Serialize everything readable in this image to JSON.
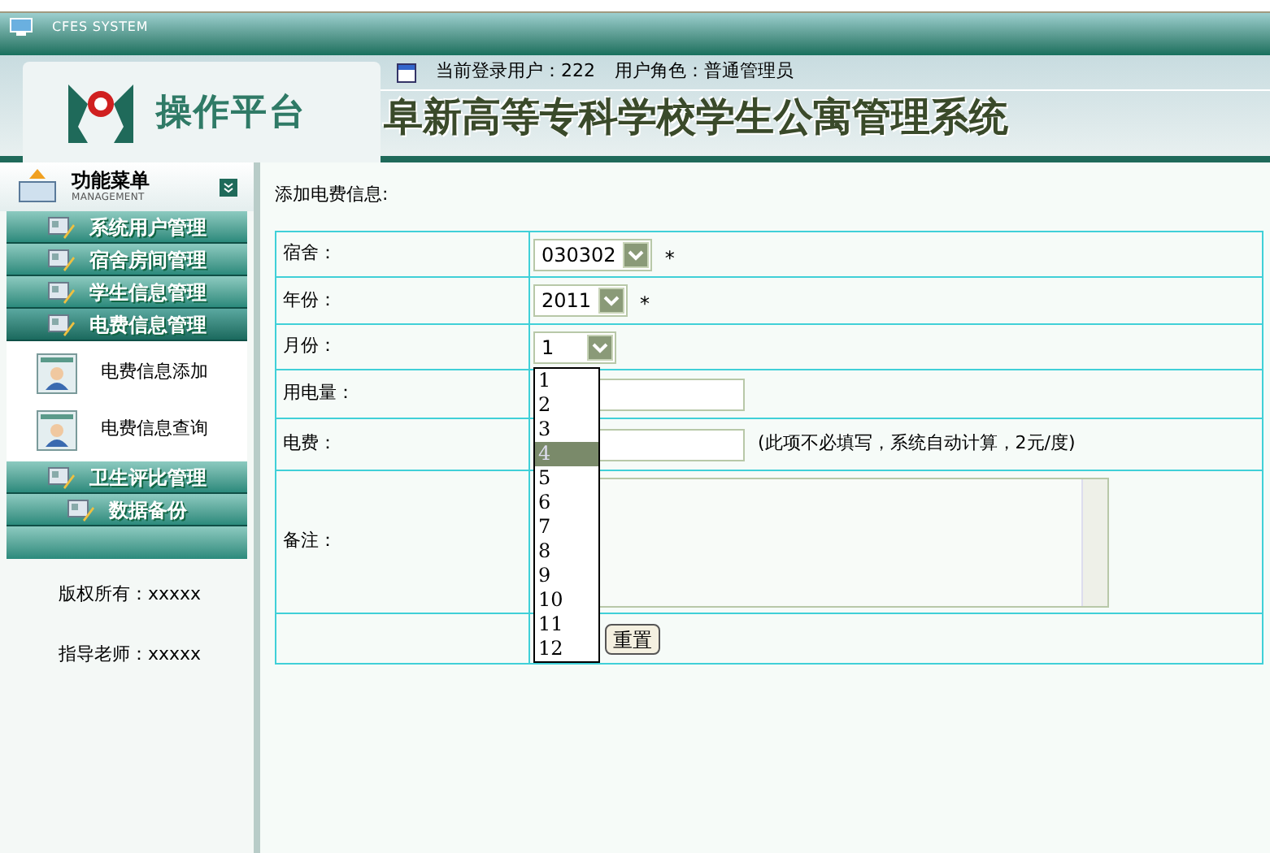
{
  "window": {
    "title": "CFES SYSTEM"
  },
  "header": {
    "logo_text": "操作平台",
    "user_info": "当前登录用户：222",
    "role_info": "用户角色：普通管理员",
    "system_title": "阜新高等专科学校学生公寓管理系统"
  },
  "sidebar": {
    "title": "功能菜单",
    "subtitle": "MANAGEMENT",
    "items": [
      {
        "label": "系统用户管理",
        "expanded": false
      },
      {
        "label": "宿舍房间管理",
        "expanded": false
      },
      {
        "label": "学生信息管理",
        "expanded": false
      },
      {
        "label": "电费信息管理",
        "expanded": true,
        "children": [
          {
            "label": "电费信息添加"
          },
          {
            "label": "电费信息查询"
          }
        ]
      },
      {
        "label": "卫生评比管理",
        "expanded": false
      },
      {
        "label": "数据备份",
        "expanded": false
      }
    ],
    "footer": [
      "版权所有：xxxxx",
      "指导老师：xxxxx"
    ]
  },
  "form": {
    "title": "添加电费信息:",
    "rows": [
      {
        "label": "宿舍：",
        "kind": "select",
        "value": "030302",
        "required": "*"
      },
      {
        "label": "年份：",
        "kind": "select",
        "value": "2011",
        "required": "*"
      },
      {
        "label": "月份：",
        "kind": "select",
        "value": "1",
        "open": true,
        "options": [
          {
            "label": "1",
            "highlighted": false
          },
          {
            "label": "2",
            "highlighted": false
          },
          {
            "label": "3",
            "highlighted": false
          },
          {
            "label": "4",
            "highlighted": true
          },
          {
            "label": "5",
            "highlighted": false
          },
          {
            "label": "6",
            "highlighted": false
          },
          {
            "label": "7",
            "highlighted": false
          },
          {
            "label": "8",
            "highlighted": false
          },
          {
            "label": "9",
            "highlighted": false
          },
          {
            "label": "10",
            "highlighted": false
          },
          {
            "label": "11",
            "highlighted": false
          },
          {
            "label": "12",
            "highlighted": false
          }
        ]
      },
      {
        "label": "用电量：",
        "kind": "input"
      },
      {
        "label": "电费：",
        "kind": "input",
        "note": "(此项不必填写，系统自动计算，2元/度)"
      },
      {
        "label": "备注：",
        "kind": "textarea"
      },
      {
        "kind": "buttons",
        "buttons": [
          "重置"
        ]
      }
    ]
  }
}
